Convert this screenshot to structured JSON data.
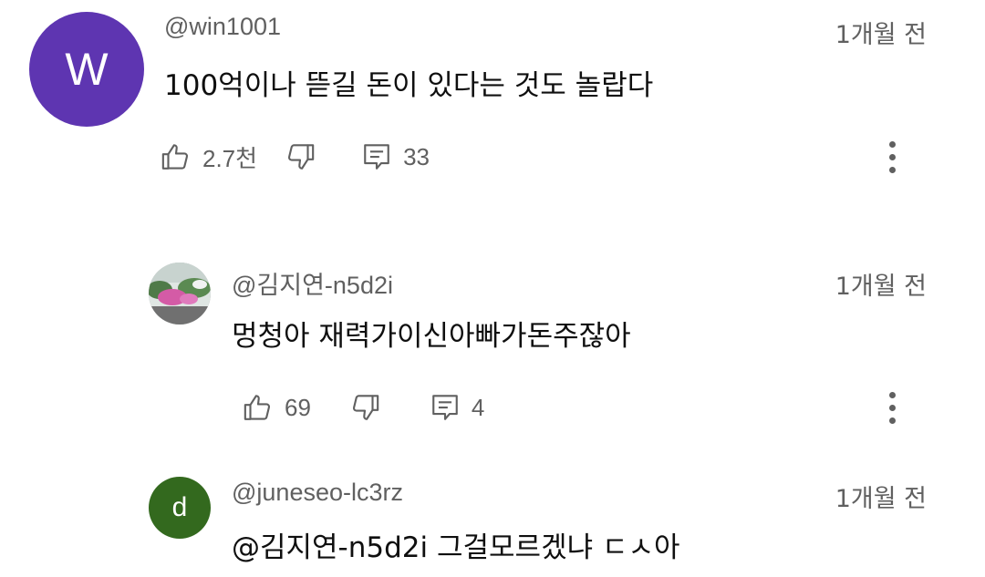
{
  "comments": [
    {
      "author": "@win1001",
      "avatar_letter": "W",
      "avatar_color": "#5e35b1",
      "time": "1개월 전",
      "text": "100억이나 뜯길 돈이 있다는 것도 놀랍다",
      "likes": "2.7천",
      "replies": "33"
    },
    {
      "author": "@김지연-n5d2i",
      "avatar_letter": "",
      "avatar_color": "#9e9e9e",
      "time": "1개월 전",
      "text": "멍청아 재력가이신아빠가돈주잖아",
      "likes": "69",
      "replies": "4"
    },
    {
      "author": "@juneseo-lc3rz",
      "avatar_letter": "d",
      "avatar_color": "#33691e",
      "time": "1개월 전",
      "text": "@김지연-n5d2i 그걸모르겠냐 ㄷㅅ아"
    }
  ],
  "icons": {
    "like": "thumb-up-outline",
    "dislike": "thumb-down-outline",
    "reply": "comment-outline",
    "more": "vertical-ellipsis"
  }
}
